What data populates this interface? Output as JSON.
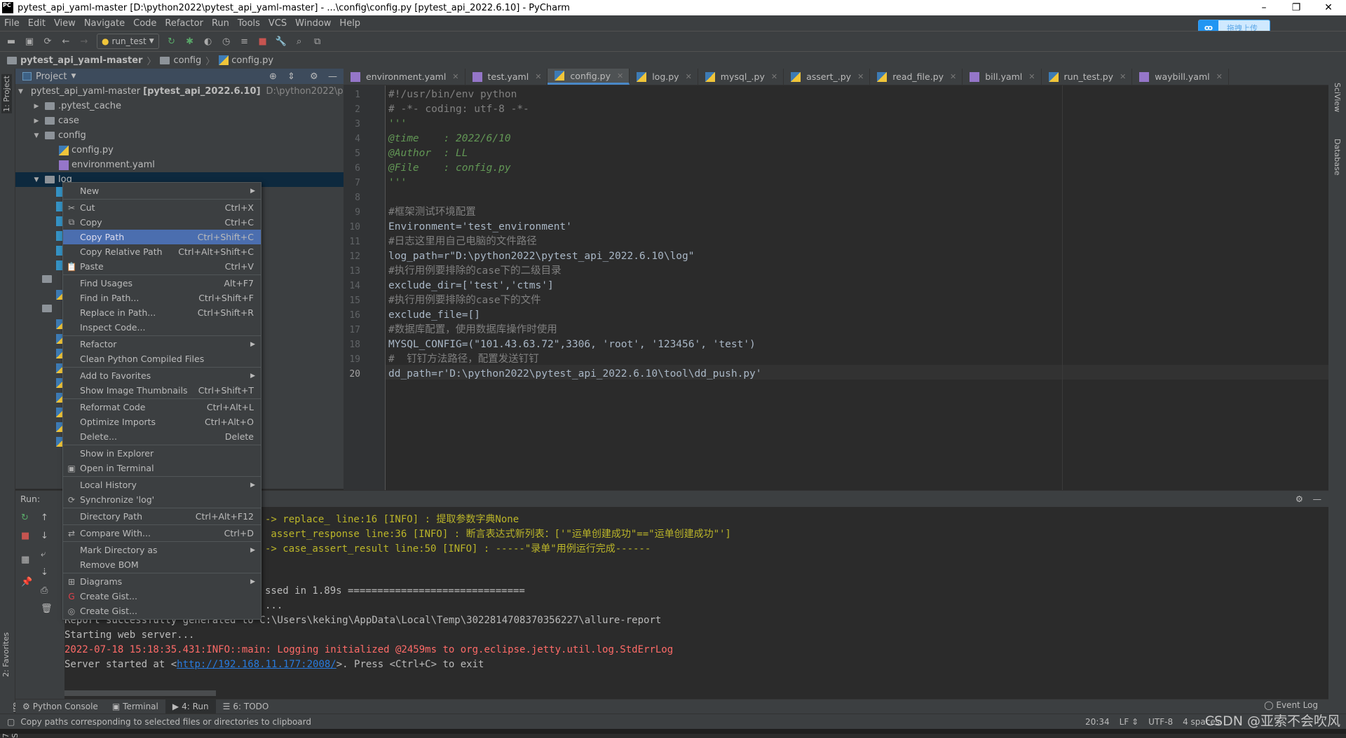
{
  "window": {
    "title": "pytest_api_yaml-master [D:\\python2022\\pytest_api_yaml-master] - ...\\config\\config.py [pytest_api_2022.6.10] - PyCharm",
    "minimize": "–",
    "restore": "❐",
    "close": "✕"
  },
  "upload_widget": {
    "label": "拖拽上传",
    "icon": "baidu-cloud-icon"
  },
  "menubar": [
    "File",
    "Edit",
    "View",
    "Navigate",
    "Code",
    "Refactor",
    "Run",
    "Tools",
    "VCS",
    "Window",
    "Help"
  ],
  "toolbar": {
    "run_config": "run_test"
  },
  "breadcrumb": [
    "pytest_api_yaml-master",
    "config",
    "config.py"
  ],
  "left_strip": {
    "project": "1: Project",
    "favorites": "2: Favorites",
    "structure": "7: Structure"
  },
  "right_strip": {
    "sciview": "SciView",
    "database": "Database"
  },
  "project_panel": {
    "title": "Project",
    "tree": [
      {
        "label": "pytest_api_yaml-master",
        "bold": "[pytest_api_2022.6.10]",
        "path": "D:\\python2022\\pytest_api_",
        "depth": 0,
        "type": "folder",
        "open": true
      },
      {
        "label": ".pytest_cache",
        "depth": 1,
        "type": "folder",
        "open": false
      },
      {
        "label": "case",
        "depth": 1,
        "type": "folder",
        "open": false
      },
      {
        "label": "config",
        "depth": 1,
        "type": "folder",
        "open": true
      },
      {
        "label": "config.py",
        "depth": 2,
        "type": "py"
      },
      {
        "label": "environment.yaml",
        "depth": 2,
        "type": "yml"
      },
      {
        "label": "log",
        "depth": 1,
        "type": "folder",
        "open": true,
        "selected": true
      }
    ]
  },
  "tabs": [
    {
      "label": "environment.yaml",
      "type": "yml"
    },
    {
      "label": "test.yaml",
      "type": "yml"
    },
    {
      "label": "config.py",
      "type": "py",
      "active": true
    },
    {
      "label": "log.py",
      "type": "py"
    },
    {
      "label": "mysql_.py",
      "type": "py"
    },
    {
      "label": "assert_.py",
      "type": "py"
    },
    {
      "label": "read_file.py",
      "type": "py"
    },
    {
      "label": "bill.yaml",
      "type": "yml"
    },
    {
      "label": "run_test.py",
      "type": "py"
    },
    {
      "label": "waybill.yaml",
      "type": "yml"
    }
  ],
  "code": [
    {
      "n": "1",
      "t": "#!/usr/bin/env python",
      "c": "cmg"
    },
    {
      "n": "2",
      "t": "# -*- coding: utf-8 -*-",
      "c": "cmg"
    },
    {
      "n": "3",
      "t": "'''",
      "c": "cm"
    },
    {
      "n": "4",
      "t": "@time    : 2022/6/10",
      "c": "cm"
    },
    {
      "n": "5",
      "t": "@Author  : LL",
      "c": "cm"
    },
    {
      "n": "6",
      "t": "@File    : config.py",
      "c": "cm"
    },
    {
      "n": "7",
      "t": "'''",
      "c": "cm"
    },
    {
      "n": "8",
      "t": "",
      "c": ""
    },
    {
      "n": "9",
      "t": "#框架测试环境配置",
      "c": "cmg"
    },
    {
      "n": "10",
      "t": "Environment='test_environment'",
      "c": ""
    },
    {
      "n": "11",
      "t": "#日志这里用自己电脑的文件路径",
      "c": "cmg"
    },
    {
      "n": "12",
      "t": "log_path=r\"D:\\python2022\\pytest_api_2022.6.10\\log\"",
      "c": ""
    },
    {
      "n": "13",
      "t": "#执行用例要排除的case下的二级目录",
      "c": "cmg"
    },
    {
      "n": "14",
      "t": "exclude_dir=['test','ctms']",
      "c": ""
    },
    {
      "n": "15",
      "t": "#执行用例要排除的case下的文件",
      "c": "cmg"
    },
    {
      "n": "16",
      "t": "exclude_file=[]",
      "c": ""
    },
    {
      "n": "17",
      "t": "#数据库配置，使用数据库操作时使用",
      "c": "cmg"
    },
    {
      "n": "18",
      "t": "MYSQL_CONFIG=(\"101.43.63.72\",3306, 'root', '123456', 'test')",
      "c": ""
    },
    {
      "n": "19",
      "t": "#  钉钉方法路径，配置发送钉钉",
      "c": "cmg"
    },
    {
      "n": "20",
      "t": "dd_path=r'D:\\python2022\\pytest_api_2022.6.10\\tool\\dd_push.py'",
      "c": ""
    }
  ],
  "run_panel": {
    "label": "Run:",
    "lines": [
      {
        "t": "-> replace_ line:16 [INFO] : 提取参数字典None",
        "c": "yl",
        "x": 0
      },
      {
        "t": " assert_response line:36 [INFO] : 断言表达式新列表：['\"运单创建成功\"==\"运单创建成功\"']",
        "c": "yl",
        "x": 0
      },
      {
        "t": "-> case_assert_result line:50 [INFO] : -----\"录单\"用例运行完成------",
        "c": "yl",
        "x": 0
      },
      {
        "t": "",
        "c": ""
      },
      {
        "t": "",
        "c": ""
      },
      {
        "t": "ssed in 1.89s ==============================",
        "c": "",
        "x": 0
      },
      {
        "t": "...",
        "c": "",
        "x": 0
      },
      {
        "t": "Report successfully generated to C:\\Users\\keking\\AppData\\Local\\Temp\\3022814708370356227\\allure-report",
        "c": "",
        "x": 1
      },
      {
        "t": "Starting web server...",
        "c": "",
        "x": 1
      },
      {
        "t": "2022-07-18 15:18:35.431:INFO::main: Logging initialized @2459ms to org.eclipse.jetty.util.log.StdErrLog",
        "c": "rd",
        "x": 1
      }
    ],
    "server_prefix": "Server started at <",
    "server_link": "http://192.168.11.177:2008/",
    "server_suffix": ">. Press <Ctrl+C> to exit"
  },
  "context_menu": [
    {
      "label": "New",
      "sub": true
    },
    {
      "sep": true
    },
    {
      "label": "Cut",
      "sc": "Ctrl+X",
      "icon": "✂"
    },
    {
      "label": "Copy",
      "sc": "Ctrl+C",
      "icon": "⧉"
    },
    {
      "label": "Copy Path",
      "sc": "Ctrl+Shift+C",
      "hl": true
    },
    {
      "label": "Copy Relative Path",
      "sc": "Ctrl+Alt+Shift+C"
    },
    {
      "label": "Paste",
      "sc": "Ctrl+V",
      "icon": "📋"
    },
    {
      "sep": true
    },
    {
      "label": "Find Usages",
      "sc": "Alt+F7"
    },
    {
      "label": "Find in Path...",
      "sc": "Ctrl+Shift+F"
    },
    {
      "label": "Replace in Path...",
      "sc": "Ctrl+Shift+R"
    },
    {
      "label": "Inspect Code..."
    },
    {
      "sep": true
    },
    {
      "label": "Refactor",
      "sub": true
    },
    {
      "label": "Clean Python Compiled Files"
    },
    {
      "sep": true
    },
    {
      "label": "Add to Favorites",
      "sub": true
    },
    {
      "label": "Show Image Thumbnails",
      "sc": "Ctrl+Shift+T"
    },
    {
      "sep": true
    },
    {
      "label": "Reformat Code",
      "sc": "Ctrl+Alt+L"
    },
    {
      "label": "Optimize Imports",
      "sc": "Ctrl+Alt+O"
    },
    {
      "label": "Delete...",
      "sc": "Delete"
    },
    {
      "sep": true
    },
    {
      "label": "Show in Explorer"
    },
    {
      "label": "Open in Terminal",
      "icon": "▣"
    },
    {
      "sep": true
    },
    {
      "label": "Local History",
      "sub": true
    },
    {
      "label": "Synchronize 'log'",
      "icon": "⟳"
    },
    {
      "sep": true
    },
    {
      "label": "Directory Path",
      "sc": "Ctrl+Alt+F12"
    },
    {
      "sep": true
    },
    {
      "label": "Compare With...",
      "sc": "Ctrl+D",
      "icon": "⇄"
    },
    {
      "sep": true
    },
    {
      "label": "Mark Directory as",
      "sub": true
    },
    {
      "label": "Remove BOM"
    },
    {
      "sep": true
    },
    {
      "label": "Diagrams",
      "sub": true,
      "icon": "⊞"
    },
    {
      "label": "Create Gist...",
      "icon": "G"
    },
    {
      "label": "Create Gist...",
      "icon": "◎"
    }
  ],
  "tool_windows": [
    {
      "label": "Python Console"
    },
    {
      "label": "Terminal"
    },
    {
      "label": "4: Run",
      "active": true
    },
    {
      "label": "6: TODO"
    }
  ],
  "event_log": "Event Log",
  "status": {
    "message": "Copy paths corresponding to selected files or directories to clipboard",
    "position": "20:34",
    "line_sep": "LF ⇕",
    "encoding": "UTF-8",
    "indent": "4 spaces"
  },
  "watermark": "CSDN @亚索不会吹风",
  "colors": {
    "accent": "#4b6eaf",
    "bg": "#2b2b2b",
    "panel": "#3c3f41",
    "warning_text": "#bbb529",
    "error_text": "#ff6b68"
  }
}
